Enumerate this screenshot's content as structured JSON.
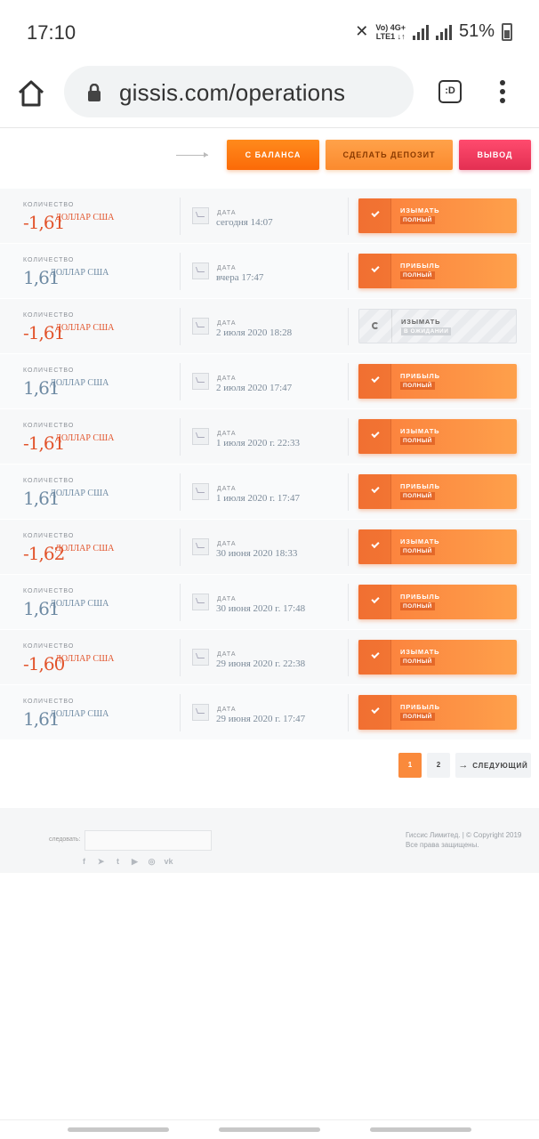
{
  "status_bar": {
    "time": "17:10",
    "network_top": "Vo) 4G+",
    "network_bottom": "LTE1 ↓↑",
    "battery": "51%"
  },
  "browser": {
    "url": "gissis.com/operations",
    "tab_label": ":D"
  },
  "filters": {
    "balance": "С БАЛАНСА",
    "deposit": "СДЕЛАТЬ ДЕПОЗИТ",
    "withdraw": "ВЫВОД"
  },
  "operations": [
    {
      "qty_label": "КОЛИЧЕСТВО",
      "amount": "-1,61",
      "unit": "ДОЛЛАР США",
      "date_label": "ДАТА",
      "date": "сегодня 14:07",
      "status": "ИЗЫМАТЬ",
      "badge": "ПОЛНЫЙ",
      "sign": "neg",
      "state": "done"
    },
    {
      "qty_label": "КОЛИЧЕСТВО",
      "amount": "1,61",
      "unit": "ДОЛЛАР США",
      "date_label": "ДАТА",
      "date": "вчера 17:47",
      "status": "ПРИБЫЛЬ",
      "badge": "ПОЛНЫЙ",
      "sign": "pos",
      "state": "done"
    },
    {
      "qty_label": "КОЛИЧЕСТВО",
      "amount": "-1,61",
      "unit": "ДОЛЛАР США",
      "date_label": "ДАТА",
      "date": "2 июля 2020 18:28",
      "status": "ИЗЫМАТЬ",
      "badge": "В ОЖИДАНИИ",
      "sign": "neg",
      "state": "pending"
    },
    {
      "qty_label": "КОЛИЧЕСТВО",
      "amount": "1,61",
      "unit": "ДОЛЛАР США",
      "date_label": "ДАТА",
      "date": "2 июля 2020 17:47",
      "status": "ПРИБЫЛЬ",
      "badge": "ПОЛНЫЙ",
      "sign": "pos",
      "state": "done"
    },
    {
      "qty_label": "КОЛИЧЕСТВО",
      "amount": "-1,61",
      "unit": "ДОЛЛАР США",
      "date_label": "ДАТА",
      "date": "1 июля 2020 г. 22:33",
      "status": "ИЗЫМАТЬ",
      "badge": "ПОЛНЫЙ",
      "sign": "neg",
      "state": "done"
    },
    {
      "qty_label": "КОЛИЧЕСТВО",
      "amount": "1,61",
      "unit": "ДОЛЛАР США",
      "date_label": "ДАТА",
      "date": "1 июля 2020 г. 17:47",
      "status": "ПРИБЫЛЬ",
      "badge": "ПОЛНЫЙ",
      "sign": "pos",
      "state": "done"
    },
    {
      "qty_label": "КОЛИЧЕСТВО",
      "amount": "-1,62",
      "unit": "ДОЛЛАР США",
      "date_label": "ДАТА",
      "date": "30 июня 2020 18:33",
      "status": "ИЗЫМАТЬ",
      "badge": "ПОЛНЫЙ",
      "sign": "neg",
      "state": "done"
    },
    {
      "qty_label": "КОЛИЧЕСТВО",
      "amount": "1,61",
      "unit": "ДОЛЛАР США",
      "date_label": "ДАТА",
      "date": "30 июня 2020 г. 17:48",
      "status": "ПРИБЫЛЬ",
      "badge": "ПОЛНЫЙ",
      "sign": "pos",
      "state": "done"
    },
    {
      "qty_label": "КОЛИЧЕСТВО",
      "amount": "-1,60",
      "unit": "ДОЛЛАР США",
      "date_label": "ДАТА",
      "date": "29 июня 2020 г. 22:38",
      "status": "ИЗЫМАТЬ",
      "badge": "ПОЛНЫЙ",
      "sign": "neg",
      "state": "done"
    },
    {
      "qty_label": "КОЛИЧЕСТВО",
      "amount": "1,61",
      "unit": "ДОЛЛАР США",
      "date_label": "ДАТА",
      "date": "29 июня 2020 г. 17:47",
      "status": "ПРИБЫЛЬ",
      "badge": "ПОЛНЫЙ",
      "sign": "pos",
      "state": "done"
    }
  ],
  "pagination": {
    "page1": "1",
    "page2": "2",
    "next": "СЛЕДУЮЩИЙ"
  },
  "footer": {
    "follow": "следовать:",
    "copyright_line1": "Гиссис Лимитед. | © Copyright 2019",
    "copyright_line2": "Все права защищены.",
    "socials": [
      "f",
      "➤",
      "t",
      "▶",
      "◎",
      "vk"
    ]
  },
  "colors": {
    "accent_orange": "#fb7d3b",
    "negative": "#e2542c",
    "positive": "#6e8aa3",
    "withdraw_red": "#e32f52"
  }
}
